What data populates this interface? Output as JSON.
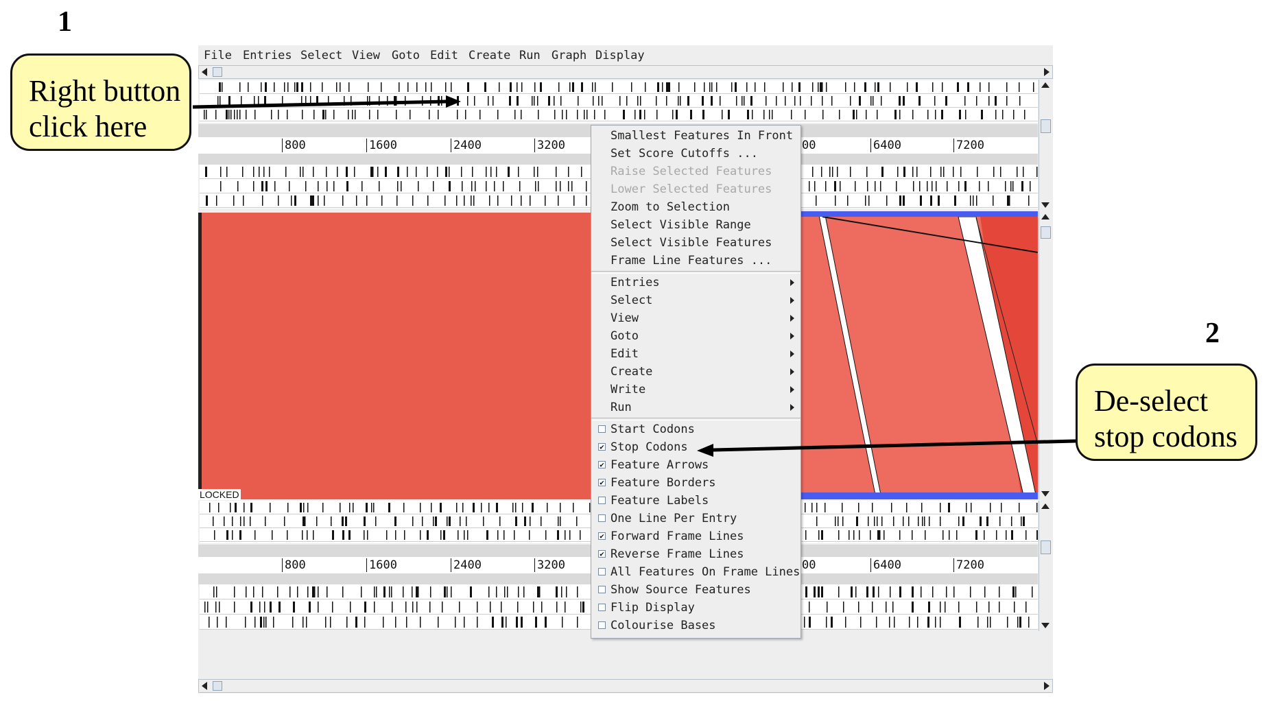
{
  "annotations": {
    "step1_number": "1",
    "step2_number": "2",
    "callout1_line1": "Right button",
    "callout1_line2": "click here",
    "callout2_line1": "De-select",
    "callout2_line2": "stop codons"
  },
  "menubar": {
    "file": "File",
    "entries": "Entries",
    "select": "Select",
    "view": "View",
    "goto": "Goto",
    "edit": "Edit",
    "create": "Create",
    "run": "Run",
    "graph": "Graph",
    "display": "Display"
  },
  "top_ruler": [
    "800",
    "1600",
    "2400",
    "3200",
    "00",
    "6400",
    "7200"
  ],
  "bottom_ruler": [
    "800",
    "1600",
    "2400",
    "3200",
    "00",
    "6400",
    "7200"
  ],
  "comparison": {
    "locked_label": "LOCKED",
    "match_color": "#e85c4e",
    "forward_color": "#e8605a",
    "reverse_color": "#4a5cf0"
  },
  "context_menu": {
    "actions": [
      {
        "label": "Smallest Features In Front",
        "enabled": true
      },
      {
        "label": "Set Score Cutoffs ...",
        "enabled": true
      },
      {
        "label": "Raise Selected Features",
        "enabled": false
      },
      {
        "label": "Lower Selected Features",
        "enabled": false
      },
      {
        "label": "Zoom to Selection",
        "enabled": true
      },
      {
        "label": "Select Visible Range",
        "enabled": true
      },
      {
        "label": "Select Visible Features",
        "enabled": true
      },
      {
        "label": "Frame Line Features ...",
        "enabled": true
      }
    ],
    "submenus": [
      "Entries",
      "Select",
      "View",
      "Goto",
      "Edit",
      "Create",
      "Write",
      "Run"
    ],
    "toggles": [
      {
        "label": "Start Codons",
        "checked": false
      },
      {
        "label": "Stop Codons",
        "checked": true
      },
      {
        "label": "Feature Arrows",
        "checked": true
      },
      {
        "label": "Feature Borders",
        "checked": true
      },
      {
        "label": "Feature Labels",
        "checked": false
      },
      {
        "label": "One Line Per Entry",
        "checked": false
      },
      {
        "label": "Forward Frame Lines",
        "checked": true
      },
      {
        "label": "Reverse Frame Lines",
        "checked": true
      },
      {
        "label": "All Features On Frame Lines",
        "checked": false
      },
      {
        "label": "Show Source Features",
        "checked": false
      },
      {
        "label": "Flip Display",
        "checked": false
      },
      {
        "label": "Colourise Bases",
        "checked": false
      }
    ]
  }
}
